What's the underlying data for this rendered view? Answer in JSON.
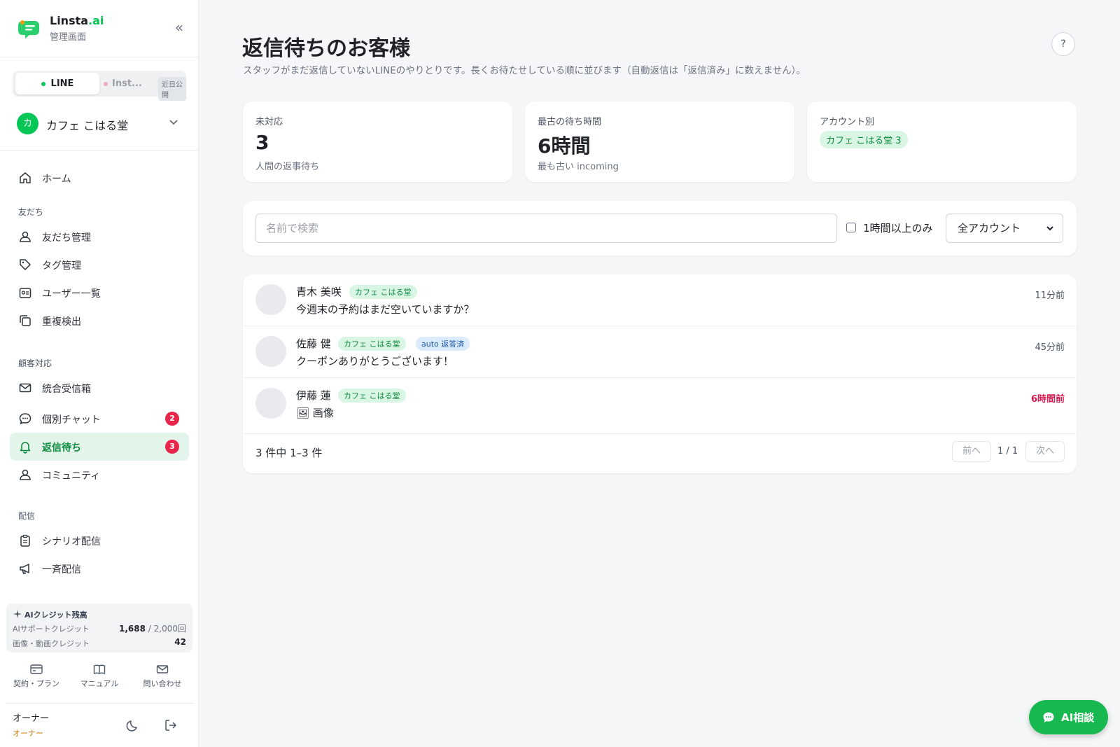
{
  "brand": {
    "name": "Linsta",
    "name_suffix": ".ai",
    "subtitle": "管理画面"
  },
  "channels": {
    "line": "LINE",
    "instagram": "Inst...",
    "coming_soon": "近日公開"
  },
  "account": {
    "initial": "カ",
    "name": "カフェ こはる堂"
  },
  "nav": {
    "home": "ホーム",
    "section_friends": "友だち",
    "friends_manage": "友だち管理",
    "tags": "タグ管理",
    "users": "ユーザー一覧",
    "duplicates": "重複検出",
    "section_support": "顧客対応",
    "inbox": "統合受信箱",
    "chat": "個別チャット",
    "chat_badge": "2",
    "waiting": "返信待ち",
    "waiting_badge": "3",
    "community": "コミュニティ",
    "section_delivery": "配信",
    "scenario": "シナリオ配信",
    "broadcast": "一斉配信"
  },
  "credits": {
    "title": "AIクレジット残高",
    "support_label": "AIサポートクレジット",
    "support_value": "1,688",
    "support_total": " / 2,000回",
    "media_label": "画像・動画クレジット",
    "media_value": "42"
  },
  "footer": {
    "plan": "契約・プラン",
    "manual": "マニュアル",
    "contact": "問い合わせ",
    "owner_name": "オーナー",
    "owner_role": "オーナー"
  },
  "page": {
    "title": "返信待ちのお客様",
    "description": "スタッフがまだ返信していないLINEのやりとりです。長くお待たせしている順に並びます（自動返信は「返信済み」に数えません）。",
    "help": "?"
  },
  "stats": {
    "pending_label": "未対応",
    "pending_value": "3",
    "pending_sub": "人間の返事待ち",
    "oldest_label": "最古の待ち時間",
    "oldest_value": "6時間",
    "oldest_sub": "最も古い incoming",
    "by_account_label": "アカウント別",
    "by_account_chip": "カフェ こはる堂 3"
  },
  "filters": {
    "search_placeholder": "名前で検索",
    "hour_only": "1時間以上のみ",
    "account_select": "全アカウント"
  },
  "rows": [
    {
      "name": "青木 美咲",
      "account": "カフェ こはる堂",
      "message": "今週末の予約はまだ空いていますか？",
      "time": "11分前"
    },
    {
      "name": "佐藤 健",
      "account": "カフェ こはる堂",
      "tag": "auto 返答済",
      "message": "クーポンありがとうございます！",
      "time": "45分前"
    },
    {
      "name": "伊藤 蓮",
      "account": "カフェ こはる堂",
      "message": "🖼 画像",
      "time": "6時間前"
    }
  ],
  "pagination": {
    "info": "3 件中 1–3 件",
    "prev": "前へ",
    "page": "1 / 1",
    "next": "次へ"
  },
  "ai_button": "AI相談",
  "colors": {
    "brand": "#06c755",
    "active_bg": "#e3f5ea",
    "badge": "#e8254b",
    "late": "#d6194f"
  }
}
